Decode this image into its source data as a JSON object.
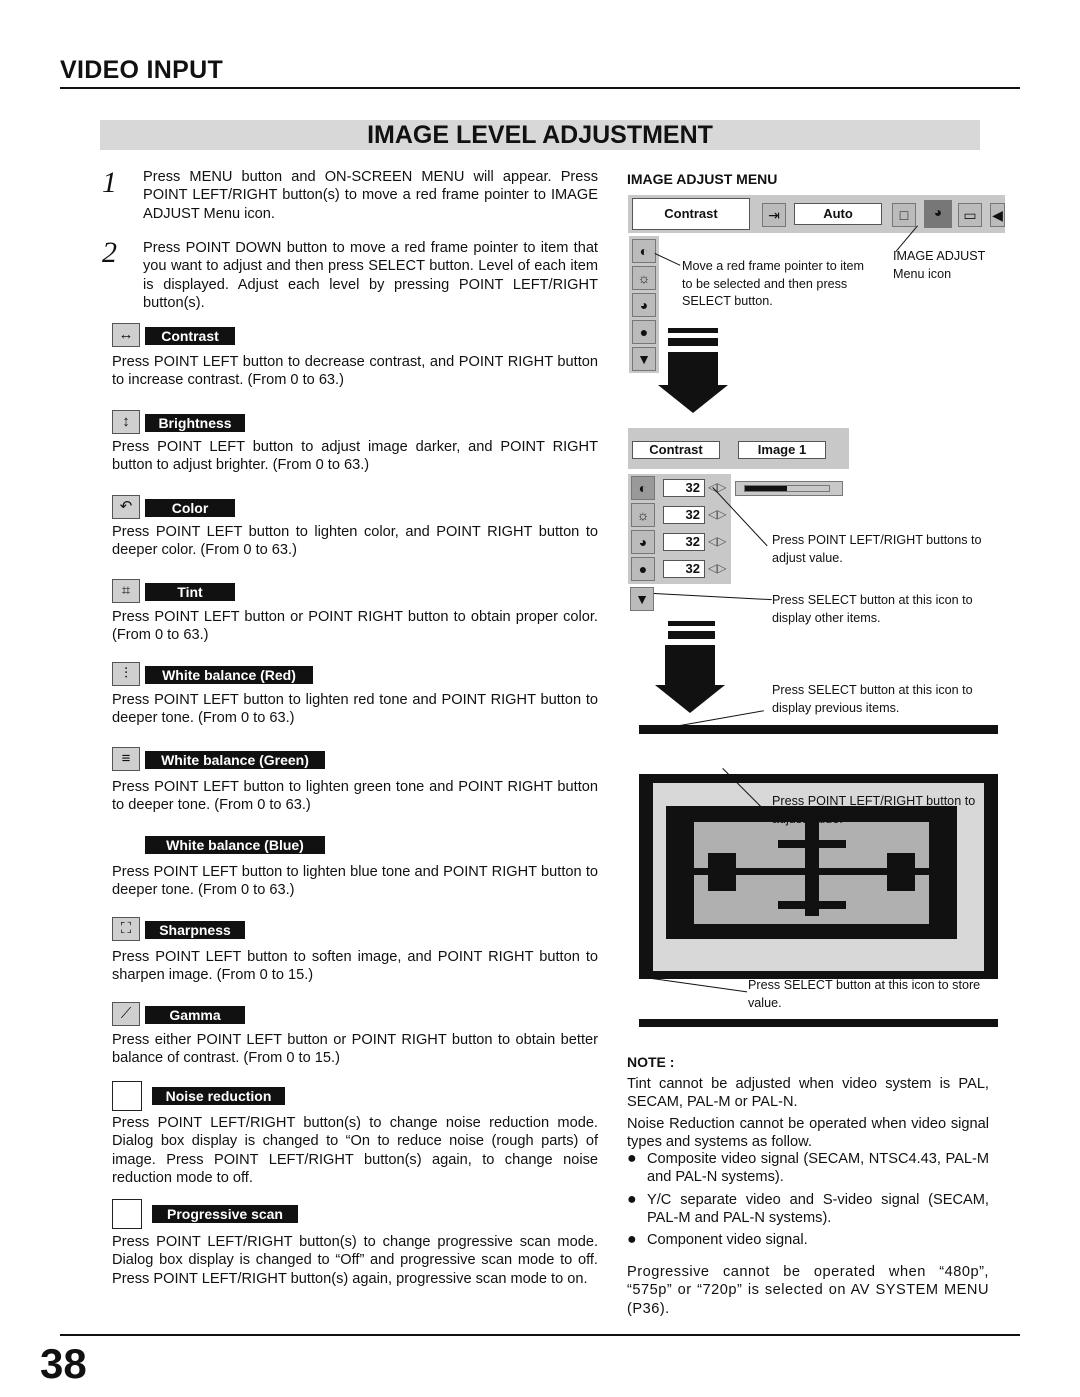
{
  "header": {
    "section": "VIDEO INPUT",
    "title": "IMAGE LEVEL ADJUSTMENT"
  },
  "steps": [
    {
      "number": "1",
      "text": "Press MENU button and ON-SCREEN MENU will appear.  Press POINT LEFT/RIGHT button(s) to move a red frame pointer to IMAGE ADJUST Menu icon."
    },
    {
      "number": "2",
      "text": "Press POINT DOWN button to move a red frame pointer to item that you want to adjust and then press SELECT button.  Level of each item is displayed.  Adjust each level by pressing POINT LEFT/RIGHT button(s)."
    }
  ],
  "items": [
    {
      "label": "Contrast",
      "icon": "contrast-icon",
      "text": "Press POINT LEFT button to decrease contrast, and POINT RIGHT button to increase contrast.  (From 0 to 63.)"
    },
    {
      "label": "Brightness",
      "icon": "brightness-icon",
      "text": "Press POINT LEFT button to adjust image darker, and POINT RIGHT button to adjust brighter.  (From 0 to 63.)"
    },
    {
      "label": "Color",
      "icon": "color-icon",
      "text": "Press POINT LEFT button to lighten color, and POINT RIGHT button to deeper color.  (From 0 to 63.)"
    },
    {
      "label": "Tint",
      "icon": "tint-icon",
      "text": "Press POINT LEFT button or POINT RIGHT button to obtain proper color.  (From 0 to 63.)"
    },
    {
      "label": "White balance (Red)",
      "icon": "white-balance-red-icon",
      "text": "Press POINT LEFT button to lighten red tone and POINT RIGHT button to deeper tone.  (From 0 to 63.)"
    },
    {
      "label": "White balance (Green)",
      "icon": "white-balance-green-icon",
      "text": "Press POINT LEFT button to lighten green tone and POINT RIGHT button to deeper tone.  (From 0 to 63.)"
    },
    {
      "label": "White balance (Blue)",
      "icon": "",
      "text": "Press POINT LEFT button to lighten blue tone and POINT RIGHT button to deeper tone.  (From 0 to 63.)"
    },
    {
      "label": "Sharpness",
      "icon": "sharpness-icon",
      "text": "Press POINT LEFT button to soften image, and POINT RIGHT button to sharpen image.  (From 0 to 15.)"
    },
    {
      "label": "Gamma",
      "icon": "gamma-icon",
      "text": "Press either POINT LEFT button or POINT RIGHT button to obtain better balance of contrast.  (From 0 to 15.)"
    },
    {
      "label": "Noise reduction",
      "icon": "blank-icon",
      "text": "Press POINT LEFT/RIGHT button(s) to change noise reduction mode.  Dialog box display is changed to “On to reduce noise (rough parts) of image. Press POINT LEFT/RIGHT button(s) again, to change noise reduction mode to off."
    },
    {
      "label": "Progressive scan",
      "icon": "blank-icon",
      "text": "Press POINT LEFT/RIGHT button(s) to change progressive scan mode.  Dialog box display is changed to “Off” and progressive scan mode to off. Press POINT LEFT/RIGHT button(s) again, progressive scan mode to on."
    }
  ],
  "menu": {
    "title": "IMAGE ADJUST MENU",
    "bar_item": "Contrast",
    "bar_mode": "Auto",
    "callout_icon": "IMAGE ADJUST\nMenu icon",
    "callout_pointer": "Move a red frame pointer to item to be selected and then press SELECT button.",
    "panel_item": "Contrast",
    "panel_mode": "Image 1",
    "values": [
      "32",
      "32",
      "32",
      "32"
    ],
    "slider_level": 0.5,
    "callout_adjust": "Press POINT LEFT/RIGHT buttons to adjust value.",
    "callout_other": "Press SELECT button at this icon to display other items.",
    "callout_previous": "Press SELECT button at this icon to display previous items.",
    "callout_adjust2": "Press POINT LEFT/RIGHT button to adjust value.",
    "callout_store": "Press SELECT button at this icon to store value."
  },
  "note": {
    "title": "NOTE :",
    "p1": "Tint cannot be adjusted when video system is PAL, SECAM, PAL-M or PAL-N.",
    "p2": "Noise Reduction cannot be operated when video signal types and systems as follow.",
    "bullets": [
      "Composite video signal (SECAM, NTSC4.43, PAL-M and PAL-N systems).",
      "Y/C separate video and S-video signal (SECAM, PAL-M and PAL-N systems).",
      "Component video signal."
    ],
    "p3": "Progressive cannot be operated when “480p”, “575p” or “720p” is selected on AV SYSTEM MENU (P36)."
  },
  "page_number": "38"
}
